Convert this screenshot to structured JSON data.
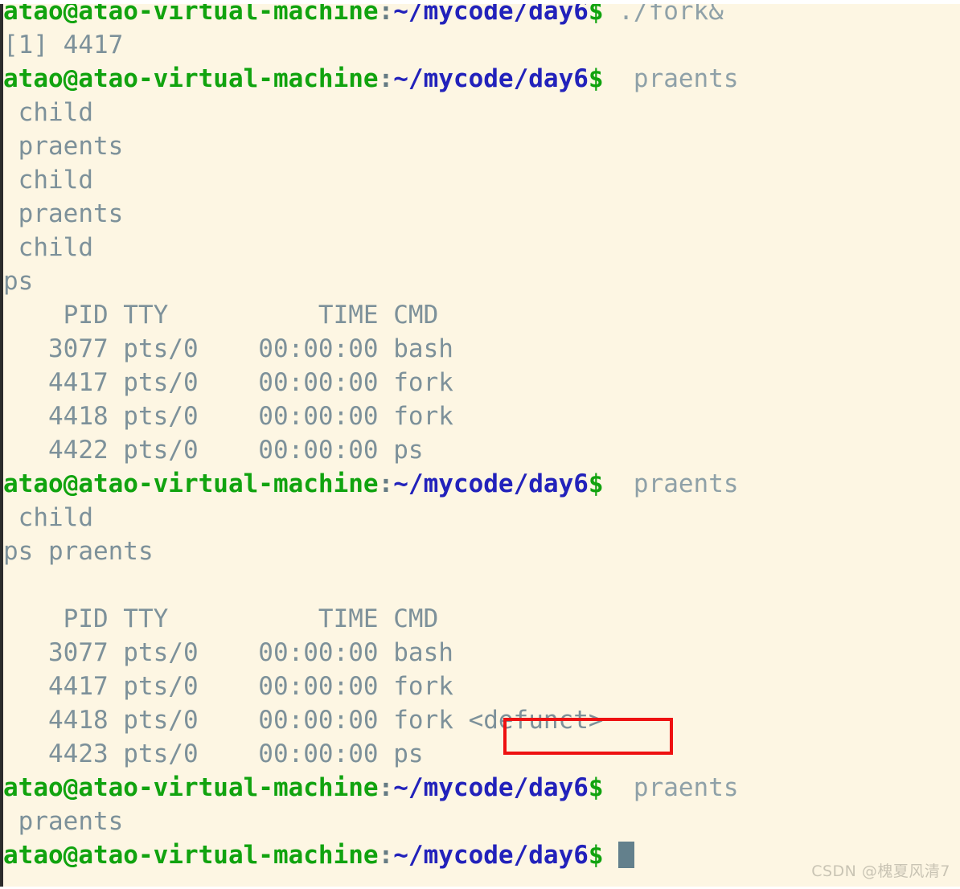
{
  "terminal": {
    "title": "atao@atao-virtual-machine: ~/mycode/day6",
    "prompt": {
      "user_host": "atao@atao-virtual-machine",
      "separator": ":",
      "path": "~/mycode/day6",
      "sigil": "$"
    },
    "colors": {
      "background": "#fdf6e3",
      "user_host": "#11a30f",
      "path": "#2222bb",
      "output_text": "#7d919a",
      "annotation_box": "#ee1111",
      "cursor": "#63808c"
    },
    "lines": [
      {
        "type": "prompt",
        "command": " ./fork&"
      },
      {
        "type": "output",
        "text": "[1] 4417"
      },
      {
        "type": "prompt",
        "command": "  praents"
      },
      {
        "type": "output",
        "text": " child"
      },
      {
        "type": "output",
        "text": " praents"
      },
      {
        "type": "output",
        "text": " child"
      },
      {
        "type": "output",
        "text": " praents"
      },
      {
        "type": "output",
        "text": " child"
      },
      {
        "type": "output",
        "text": "ps"
      },
      {
        "type": "output",
        "text": "    PID TTY          TIME CMD"
      },
      {
        "type": "output",
        "text": "   3077 pts/0    00:00:00 bash"
      },
      {
        "type": "output",
        "text": "   4417 pts/0    00:00:00 fork"
      },
      {
        "type": "output",
        "text": "   4418 pts/0    00:00:00 fork"
      },
      {
        "type": "output",
        "text": "   4422 pts/0    00:00:00 ps"
      },
      {
        "type": "prompt",
        "command": "  praents"
      },
      {
        "type": "output",
        "text": " child"
      },
      {
        "type": "output",
        "text": "ps praents"
      },
      {
        "type": "output",
        "text": ""
      },
      {
        "type": "output",
        "text": "    PID TTY          TIME CMD"
      },
      {
        "type": "output",
        "text": "   3077 pts/0    00:00:00 bash"
      },
      {
        "type": "output",
        "text": "   4417 pts/0    00:00:00 fork"
      },
      {
        "type": "output",
        "text": "   4418 pts/0    00:00:00 fork <defunct>"
      },
      {
        "type": "output",
        "text": "   4423 pts/0    00:00:00 ps"
      },
      {
        "type": "prompt",
        "command": "  praents"
      },
      {
        "type": "output",
        "text": " praents"
      },
      {
        "type": "prompt-cursor",
        "command": " "
      }
    ],
    "ps_tables": [
      {
        "headers": [
          "PID",
          "TTY",
          "TIME",
          "CMD"
        ],
        "rows": [
          [
            "3077",
            "pts/0",
            "00:00:00",
            "bash"
          ],
          [
            "4417",
            "pts/0",
            "00:00:00",
            "fork"
          ],
          [
            "4418",
            "pts/0",
            "00:00:00",
            "fork"
          ],
          [
            "4422",
            "pts/0",
            "00:00:00",
            "ps"
          ]
        ]
      },
      {
        "headers": [
          "PID",
          "TTY",
          "TIME",
          "CMD"
        ],
        "rows": [
          [
            "3077",
            "pts/0",
            "00:00:00",
            "bash"
          ],
          [
            "4417",
            "pts/0",
            "00:00:00",
            "fork"
          ],
          [
            "4418",
            "pts/0",
            "00:00:00",
            "fork <defunct>"
          ],
          [
            "4423",
            "pts/0",
            "00:00:00",
            "ps"
          ]
        ]
      }
    ],
    "job_notice": "[1] 4417",
    "annotation": {
      "target_text": "<defunct>"
    }
  },
  "watermark": {
    "text": "CSDN @槐夏风清7"
  }
}
